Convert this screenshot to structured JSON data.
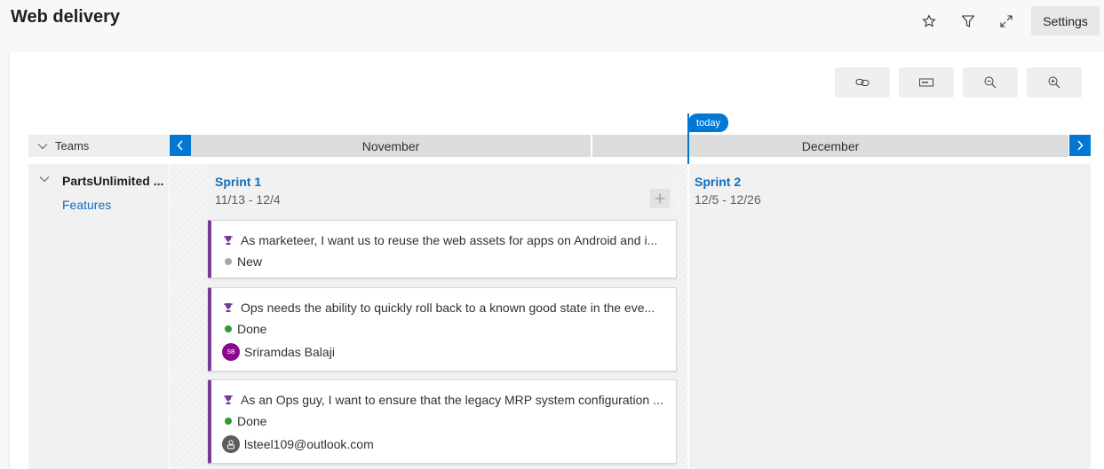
{
  "header": {
    "title": "Web delivery",
    "settings_label": "Settings",
    "icons": [
      "star-icon",
      "filter-icon",
      "expand-icon"
    ]
  },
  "toolbar": {
    "icons": [
      "link-icon",
      "card-fields-icon",
      "zoom-out-icon",
      "zoom-in-icon"
    ]
  },
  "timeline": {
    "teams_label": "Teams",
    "today_label": "today",
    "months": [
      "November",
      "December"
    ]
  },
  "team": {
    "name": "PartsUnlimited ...",
    "backlog_link": "Features"
  },
  "sprints": [
    {
      "name": "Sprint 1",
      "dates": "11/13 - 12/4"
    },
    {
      "name": "Sprint 2",
      "dates": "12/5 - 12/26"
    }
  ],
  "cards": [
    {
      "title": "As marketeer, I want us to reuse the web assets for apps on Android and i...",
      "state": "New",
      "state_color": "#a6a6a6"
    },
    {
      "title": "Ops needs the ability to quickly roll back to a known good state in the eve...",
      "state": "Done",
      "state_color": "#339933",
      "assignee": "Sriramdas Balaji",
      "assignee_initials": "SB",
      "avatar_color": "#8b0a8b"
    },
    {
      "title": "As an Ops guy, I want to ensure that the legacy MRP system configuration ...",
      "state": "Done",
      "state_color": "#339933",
      "assignee": "lsteel109@outlook.com",
      "avatar_color": "#5c5c5c"
    }
  ],
  "colors": {
    "accent": "#0078d4",
    "feature": "#773b93",
    "link": "#106ebe"
  }
}
